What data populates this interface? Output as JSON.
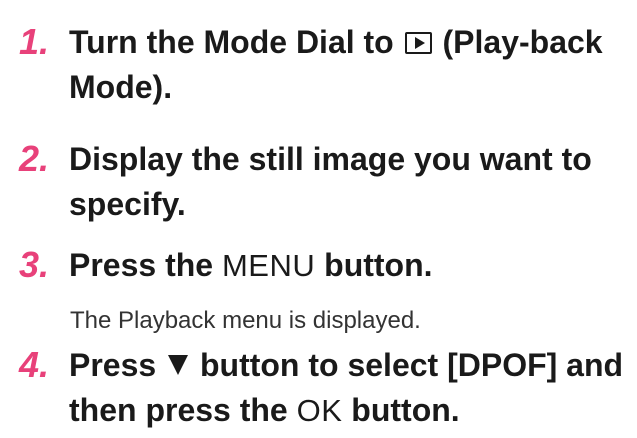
{
  "colors": {
    "accent": "#e8417a",
    "text": "#1a1a1a"
  },
  "steps": [
    {
      "number": "1.",
      "text_before": "Turn the Mode Dial to",
      "icon": "playback-mode-icon",
      "text_after": "(Play-back Mode)."
    },
    {
      "number": "2.",
      "text": "Display the still image you want to specify."
    },
    {
      "number": "3.",
      "text_before": "Press the",
      "button_label": "MENU",
      "text_after": "button.",
      "note": "The Playback menu is displayed."
    },
    {
      "number": "4.",
      "text_before": "Press",
      "icon": "down-arrow-icon",
      "text_middle": "button to select [DPOF] and then press the",
      "button_label": "OK",
      "text_after": "button."
    }
  ]
}
